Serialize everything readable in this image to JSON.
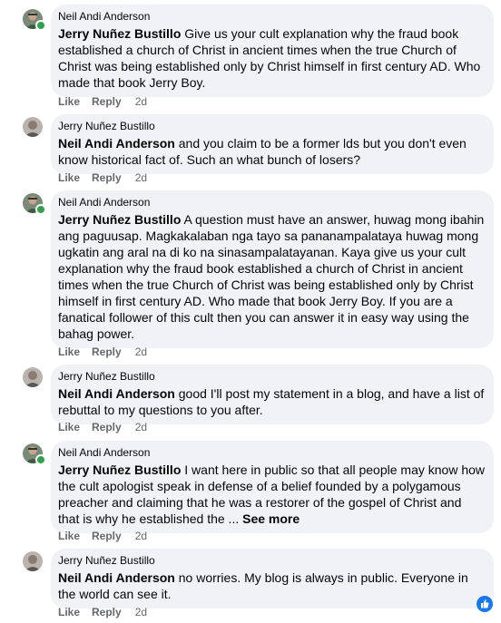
{
  "comments": [
    {
      "author": "Neil Andi Anderson",
      "mention": "Jerry Nuñez Bustillo",
      "text": " Give us your cult explanation why the fraud book established a church of Christ in ancient times when the true Church of Christ was being established only by Christ himself in first century AD. Who made that book Jerry Boy.",
      "like": "Like",
      "reply": "Reply",
      "time": "2d",
      "avatar": "neil",
      "see_more": ""
    },
    {
      "author": "Jerry Nuñez Bustillo",
      "mention": "Neil Andi Anderson",
      "text": " and you claim to be a former lds but you don't even know historical fact of. Such an what bunch of losers?",
      "like": "Like",
      "reply": "Reply",
      "time": "2d",
      "avatar": "jerry",
      "see_more": ""
    },
    {
      "author": "Neil Andi Anderson",
      "mention": "Jerry Nuñez Bustillo",
      "text": " A question must have an answer, huwag mong ibahin ang paguusap. Magkakalaban nga tayo sa pananampalataya huwag mong ugkatin ang aral na di ko na sinasampalatayanan. Kaya give us your cult explanation why the fraud book established a church of Christ in ancient times when the true Church of Christ was being established only by Christ himself in first century AD. Who made that book Jerry Boy. If you are a fanatical follower of this cult then you can answer it in easy way using the bahag power.",
      "like": "Like",
      "reply": "Reply",
      "time": "2d",
      "avatar": "neil",
      "see_more": ""
    },
    {
      "author": "Jerry Nuñez Bustillo",
      "mention": "Neil Andi Anderson",
      "text": " good I'll post my statement in a blog, and have a list of rebuttal to my questions to you after.",
      "like": "Like",
      "reply": "Reply",
      "time": "2d",
      "avatar": "jerry",
      "see_more": ""
    },
    {
      "author": "Neil Andi Anderson",
      "mention": "Jerry Nuñez Bustillo",
      "text": " I want here in public so that all people may know how the cult apologist speak in defense of a belief founded by a polygamous preacher and claiming that he was a restorer of the gospel of Christ and that is why he established the ... ",
      "like": "Like",
      "reply": "Reply",
      "time": "2d",
      "avatar": "neil",
      "see_more": "See more"
    },
    {
      "author": "Jerry Nuñez Bustillo",
      "mention": "Neil Andi Anderson",
      "text": " no worries. My blog is always in public. Everyone in the world can see it.",
      "like": "Like",
      "reply": "Reply",
      "time": "2d",
      "avatar": "jerry",
      "see_more": ""
    }
  ],
  "reaction_icon": "thumbs-up-icon",
  "colors": {
    "bubble": "#f0f2f5",
    "meta": "#65676b",
    "online": "#31a24c",
    "like_blue": "#1877f2"
  }
}
